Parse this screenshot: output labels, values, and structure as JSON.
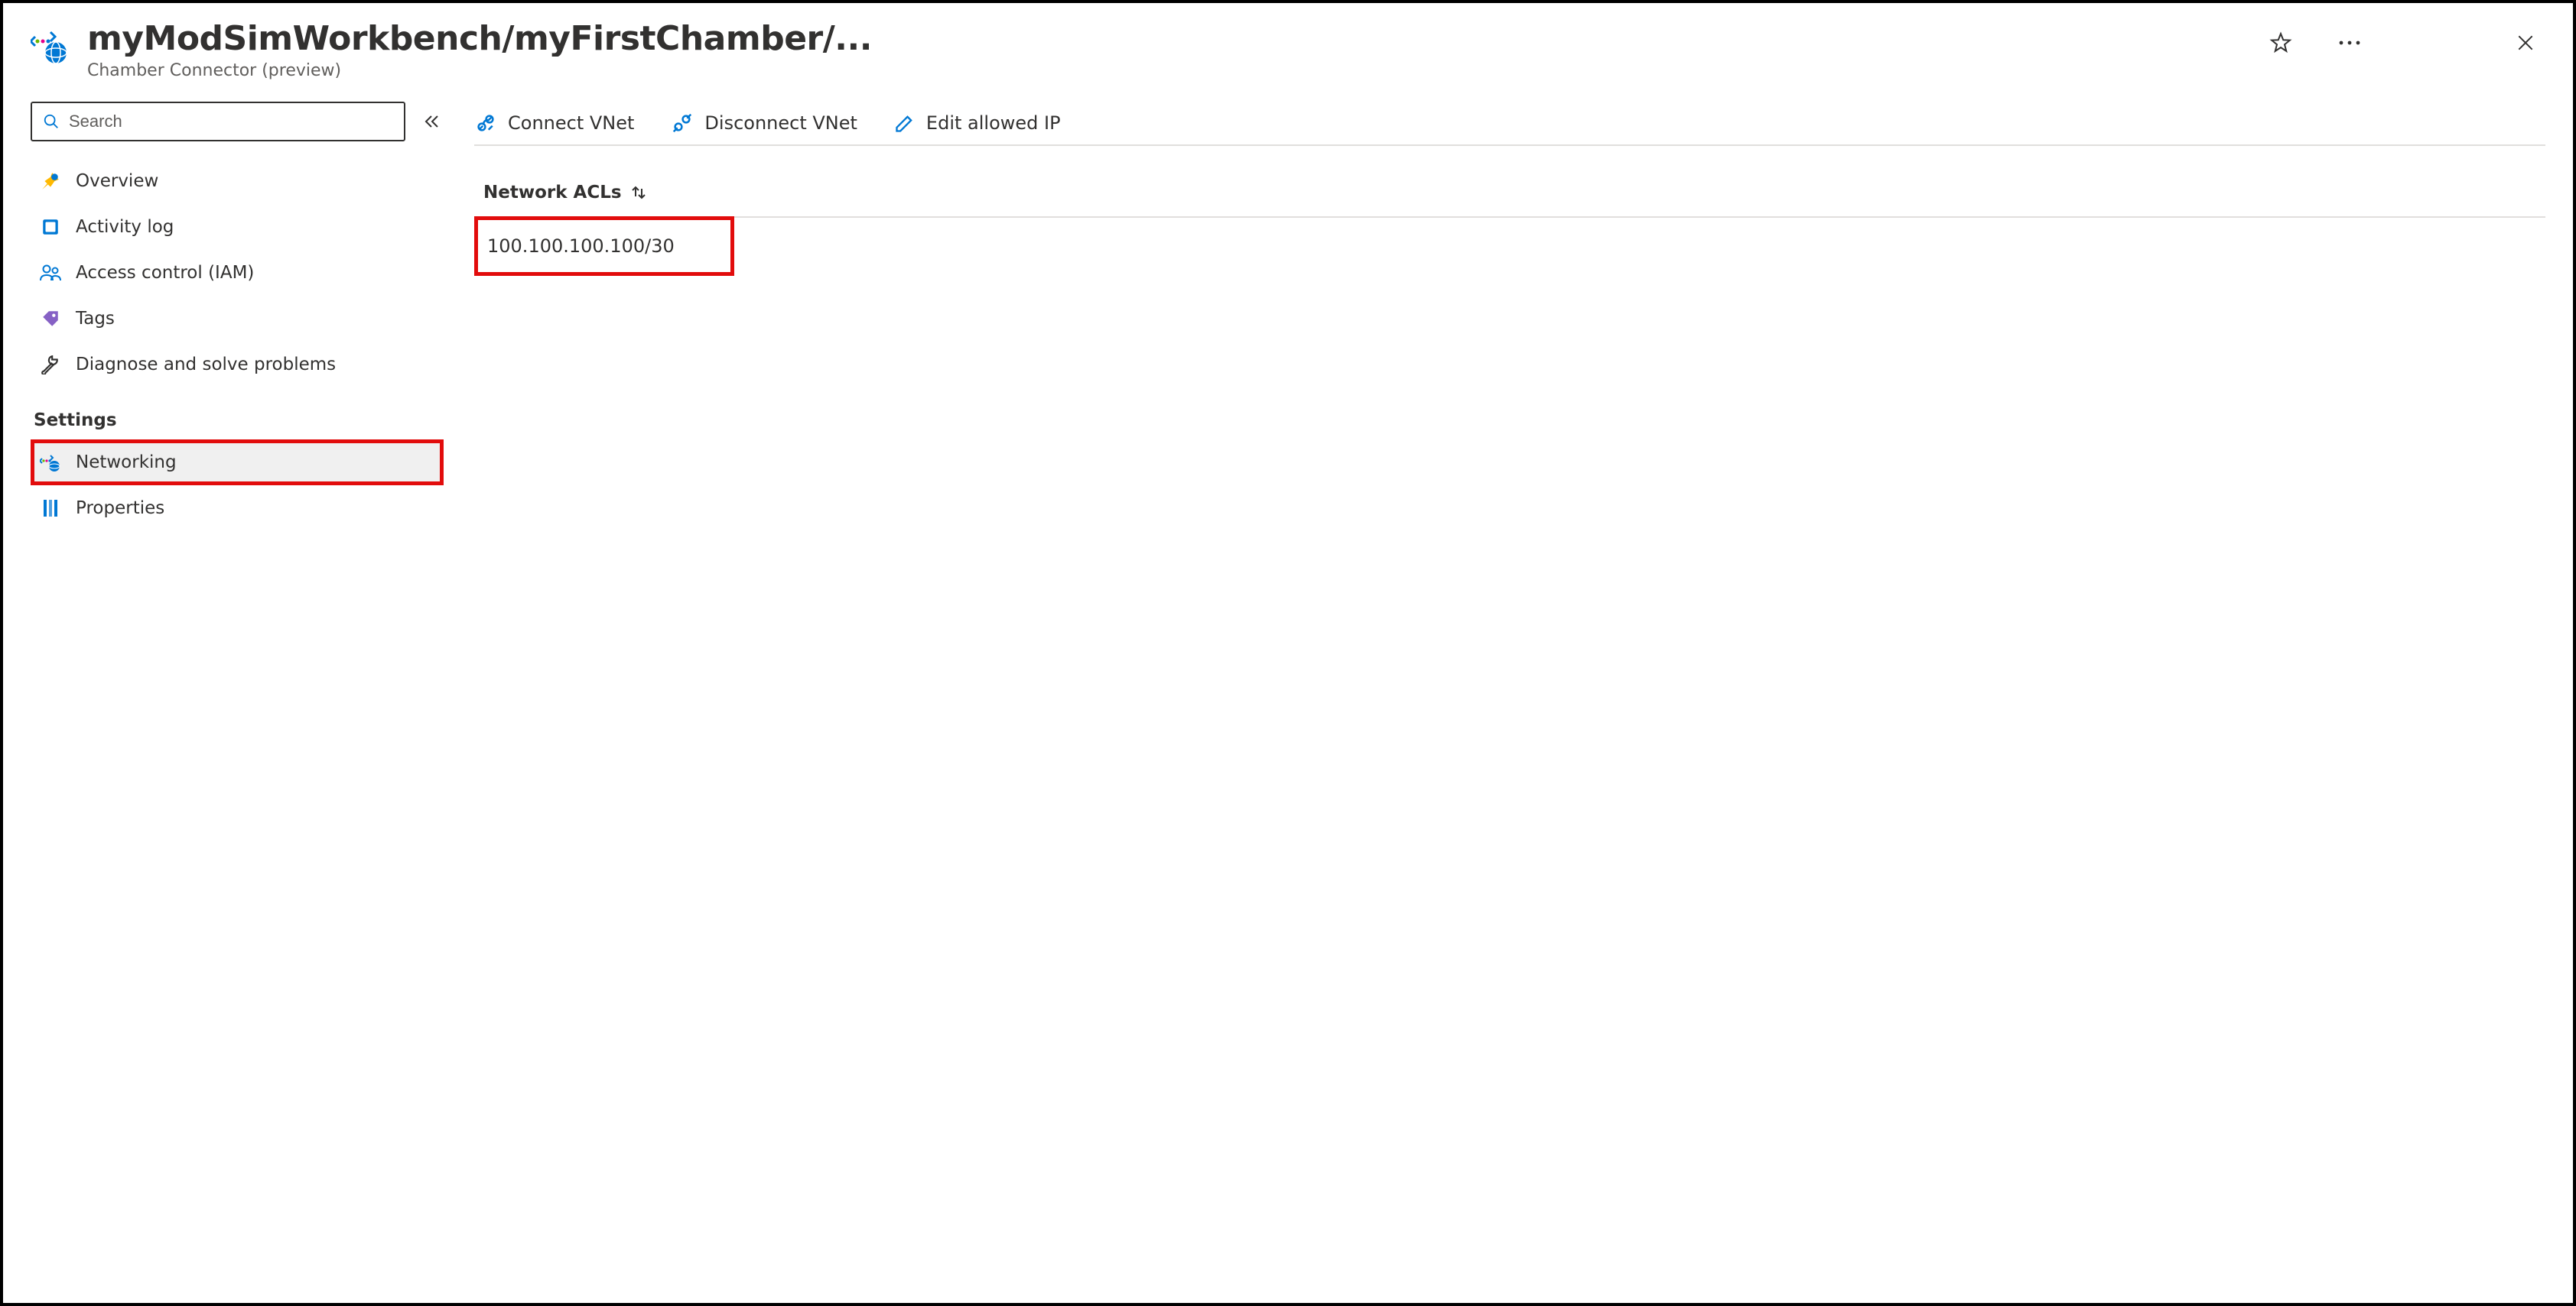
{
  "header": {
    "title": "myModSimWorkbench/myFirstChamber/...",
    "subtitle": "Chamber Connector (preview)"
  },
  "search": {
    "placeholder": "Search"
  },
  "nav": {
    "items": [
      {
        "label": "Overview"
      },
      {
        "label": "Activity log"
      },
      {
        "label": "Access control (IAM)"
      },
      {
        "label": "Tags"
      },
      {
        "label": "Diagnose and solve problems"
      }
    ],
    "settings_group_label": "Settings",
    "settings_items": [
      {
        "label": "Networking"
      },
      {
        "label": "Properties"
      }
    ]
  },
  "toolbar": {
    "connect_label": "Connect VNet",
    "disconnect_label": "Disconnect VNet",
    "edit_ip_label": "Edit allowed IP"
  },
  "table": {
    "column_header": "Network ACLs",
    "rows": [
      {
        "value": "100.100.100.100/30"
      }
    ]
  }
}
